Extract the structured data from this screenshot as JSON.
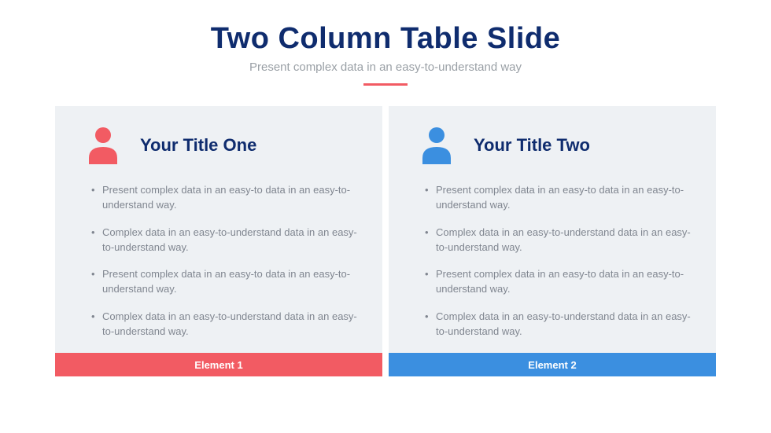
{
  "header": {
    "title": "Two Column Table Slide",
    "subtitle": "Present complex data in an easy-to-understand way"
  },
  "colors": {
    "accent_red": "#f25b63",
    "accent_blue": "#3b8fe0",
    "title_navy": "#0f2c6e"
  },
  "columns": [
    {
      "icon": "person-icon",
      "icon_color": "#f25b63",
      "title": "Your Title One",
      "bullets": [
        "Present complex data in an easy-to data in an easy-to-understand way.",
        "Complex data in an easy-to-understand data in an easy-to-understand way.",
        "Present complex data in an easy-to data in an easy-to-understand way.",
        "Complex data in an easy-to-understand data in an easy-to-understand way."
      ],
      "footer_label": "Element 1",
      "footer_color": "#f25b63"
    },
    {
      "icon": "person-icon",
      "icon_color": "#3b8fe0",
      "title": "Your Title Two",
      "bullets": [
        "Present complex data in an easy-to data in an easy-to-understand way.",
        "Complex data in an easy-to-understand data in an easy-to-understand way.",
        "Present complex data in an easy-to data in an easy-to-understand way.",
        "Complex data in an easy-to-understand data in an easy-to-understand way."
      ],
      "footer_label": "Element 2",
      "footer_color": "#3b8fe0"
    }
  ]
}
